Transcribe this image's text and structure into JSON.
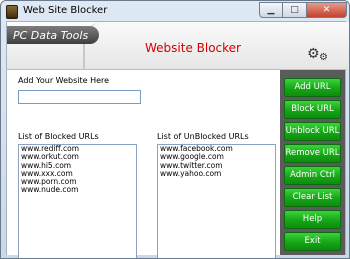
{
  "window": {
    "title": "Web Site Blocker"
  },
  "header": {
    "brand": "PC Data Tools",
    "heading": "Website Blocker"
  },
  "form": {
    "add_label": "Add Your Website Here",
    "input_value": "",
    "input_placeholder": ""
  },
  "blocked": {
    "label": "List of Blocked URLs",
    "items": [
      "www.rediff.com",
      "www.orkut.com",
      "www.hi5.com",
      "www.xxx.com",
      "www.porn.com",
      "www.nude.com"
    ]
  },
  "unblocked": {
    "label": "List of UnBlocked URLs",
    "items": [
      "www.facebook.com",
      "www.google.com",
      "www.twitter.com",
      "www.yahoo.com"
    ]
  },
  "buttons": {
    "add": "Add URL",
    "block": "Block URL",
    "unblock": "Unblock URL",
    "remove": "Remove URL",
    "admin": "Admin Ctrl",
    "clear": "Clear List",
    "help": "Help",
    "exit": "Exit"
  },
  "colors": {
    "accent_green": "#16a616",
    "heading_red": "#d40000",
    "sidebar_gray": "#5b5b5b"
  }
}
